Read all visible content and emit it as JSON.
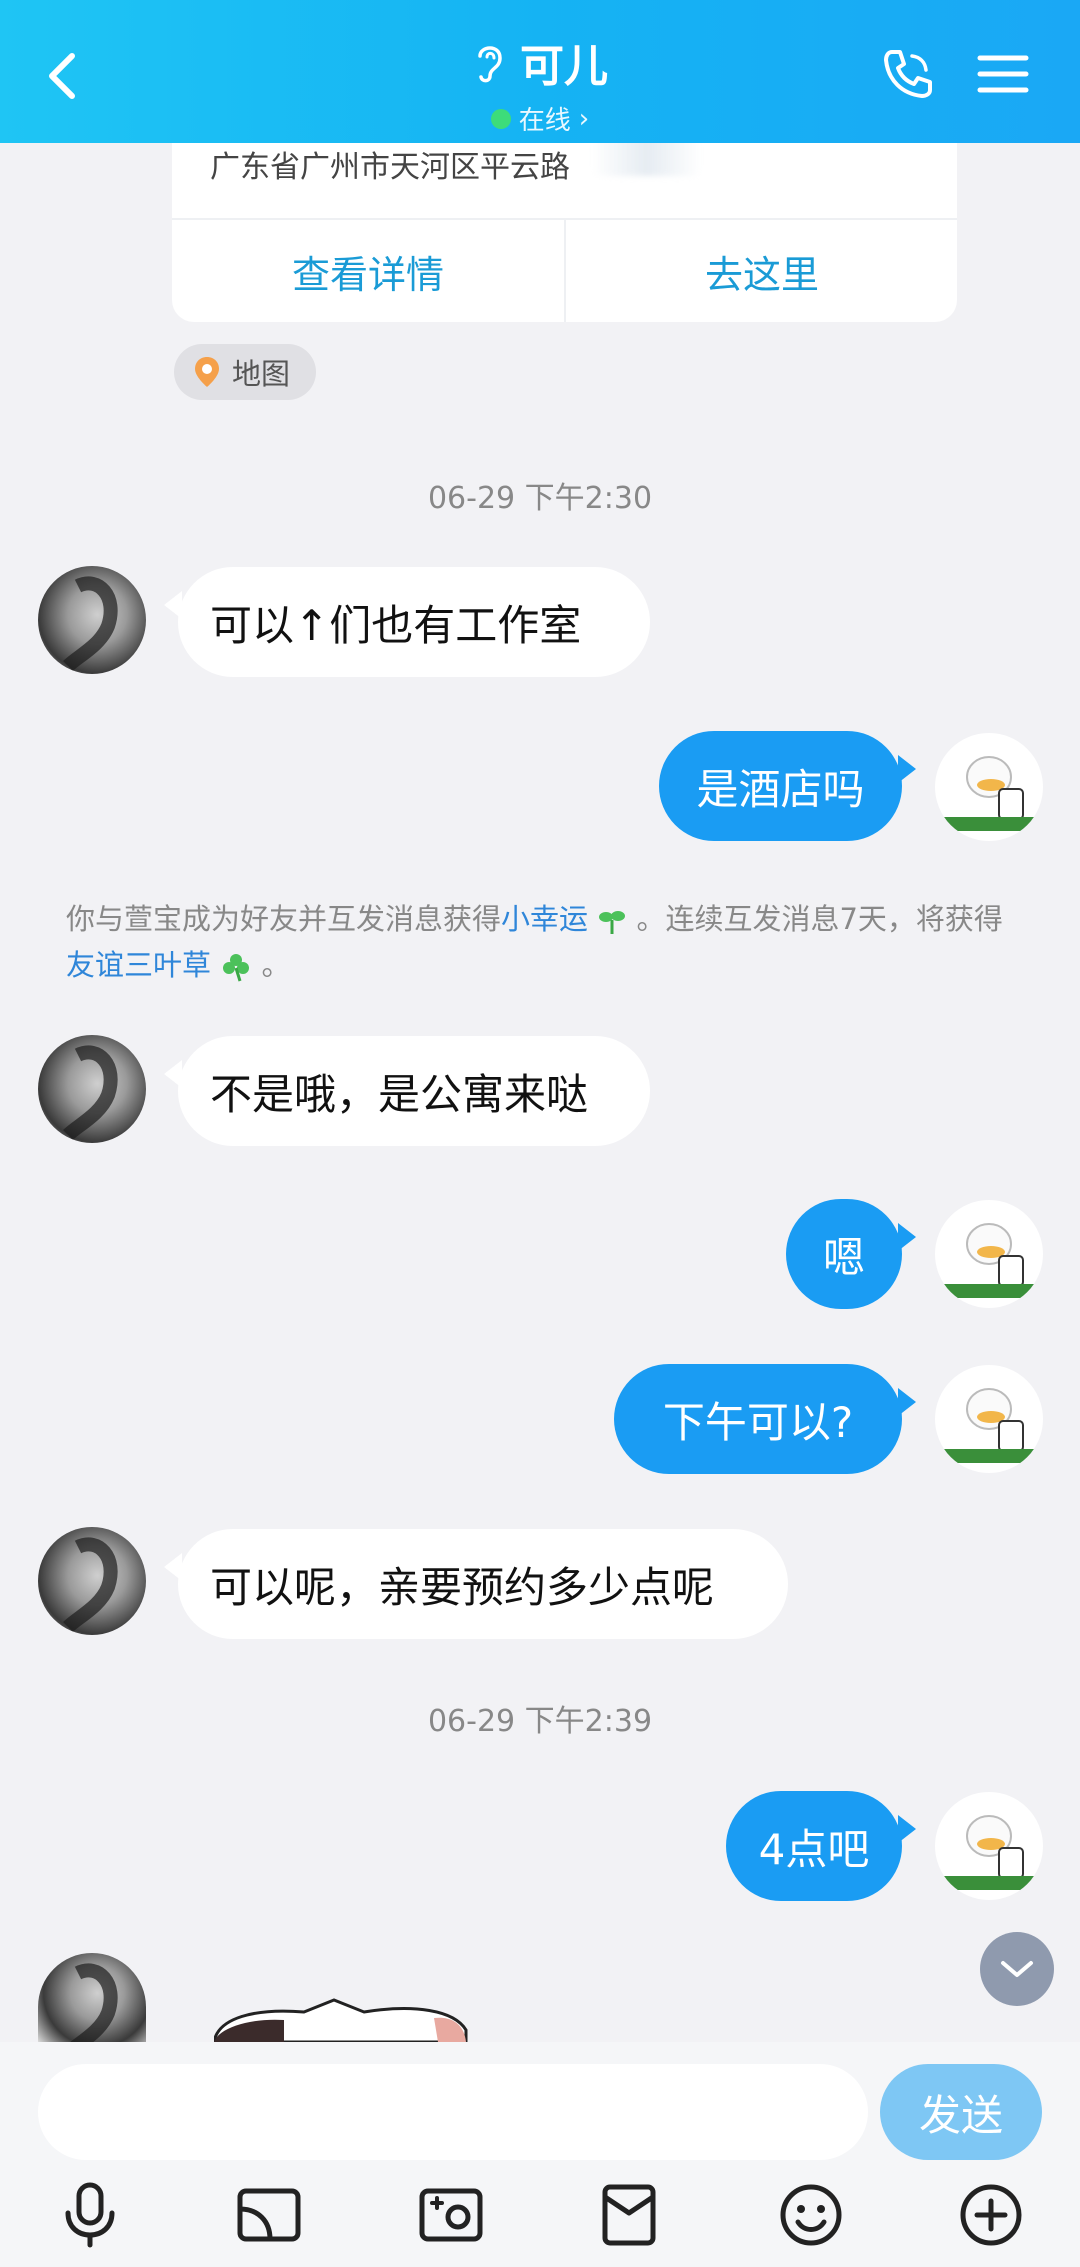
{
  "header": {
    "title": "可儿",
    "status": "在线",
    "status_chevron": "›",
    "icons": [
      "back-arrow-icon",
      "ear-icon",
      "phone-icon",
      "menu-icon"
    ],
    "bg_color": "#15b3f3"
  },
  "location_card": {
    "address": "广东省广州市天河区平云路",
    "view_details": "查看详情",
    "go_here": "去这里"
  },
  "map_tag": {
    "label": "地图",
    "icon": "location-pin-icon"
  },
  "timestamps": [
    "06-29 下午2:30",
    "06-29 下午2:39"
  ],
  "messages": [
    {
      "side": "them",
      "text": "可以↑们也有工作室"
    },
    {
      "side": "me",
      "text": "是酒店吗"
    },
    {
      "side": "them",
      "text": "不是哦，是公寓来哒"
    },
    {
      "side": "me",
      "text": "嗯"
    },
    {
      "side": "me",
      "text": "下午可以?"
    },
    {
      "side": "them",
      "text": "可以呢，亲要预约多少点呢"
    },
    {
      "side": "me",
      "text": "4点吧"
    }
  ],
  "system_note": {
    "part1": "你与萱宝成为好友并互发消息获得",
    "link1": "小幸运",
    "part2": "。连续互发消息7天，将获得",
    "link2": "友谊三叶草",
    "part3": "。"
  },
  "input": {
    "placeholder": "",
    "value": ""
  },
  "send_button": "发送",
  "toolbar": [
    "microphone-icon",
    "screen-cast-icon",
    "photo-icon",
    "red-packet-icon",
    "emoji-icon",
    "plus-icon"
  ],
  "colors": {
    "my_bubble": "#1a9cf3",
    "their_bubble": "#ffffff",
    "link": "#2f86d9",
    "send_button": "#7ec7f4"
  }
}
